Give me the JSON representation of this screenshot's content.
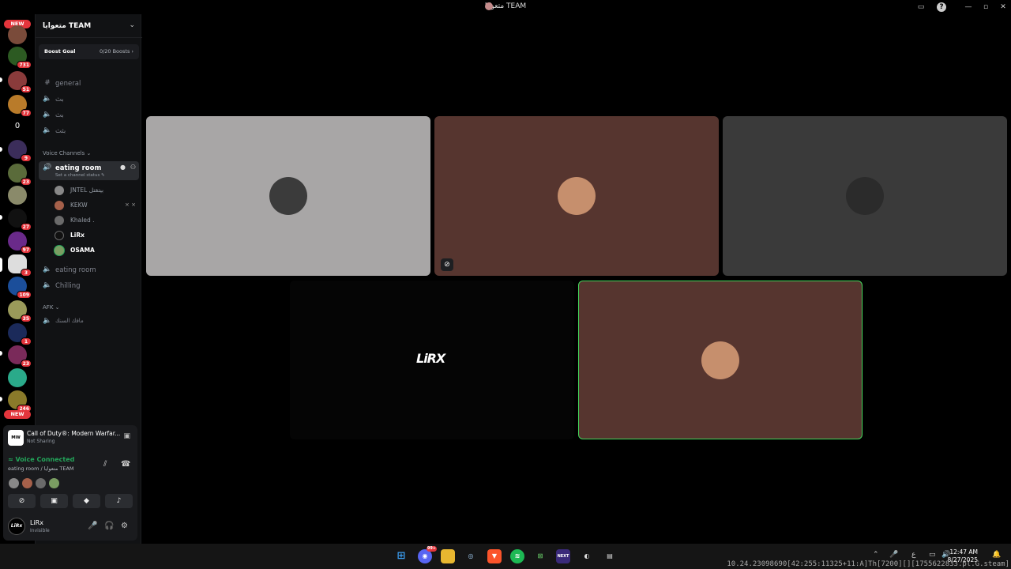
{
  "window": {
    "title": "متعوايا TEAM"
  },
  "rail": {
    "new_label": "NEW",
    "servers": [
      {
        "badge": ""
      },
      {
        "badge": "731"
      },
      {
        "badge": "51"
      },
      {
        "badge": "77"
      },
      {
        "label": "0",
        "badge": ""
      },
      {
        "badge": "9"
      },
      {
        "badge": "23"
      },
      {
        "badge": ""
      },
      {
        "badge": "27"
      },
      {
        "badge": "97"
      },
      {
        "badge": "3"
      },
      {
        "badge": "109"
      },
      {
        "badge": "35"
      },
      {
        "badge": "1"
      },
      {
        "badge": "23"
      },
      {
        "badge": ""
      },
      {
        "badge": "246"
      }
    ]
  },
  "server": {
    "name": "متعوايا TEAM",
    "boost_label": "Boost Goal",
    "boost_count": "0/20 Boosts ›"
  },
  "text_channels": [
    {
      "name": "general"
    },
    {
      "name": "بث"
    },
    {
      "name": "بث"
    },
    {
      "name": "بثث"
    }
  ],
  "voice_category": "Voice Channels ⌄",
  "active_channel": {
    "name": "eating room",
    "status": "Set a channel status ✎"
  },
  "members": [
    {
      "name": "JNTEL بيتقتل",
      "color": "#888888"
    },
    {
      "name": "KEKW",
      "color": "#a5604a",
      "icons": "⨯ ⨯"
    },
    {
      "name": "Khaled .",
      "color": "#6a6a6a"
    },
    {
      "name": "LiRx",
      "color": "#111111"
    },
    {
      "name": "OSAMA",
      "color": "#7a9d62"
    }
  ],
  "other_channels": [
    {
      "name": "eating room"
    },
    {
      "name": "Chilling"
    }
  ],
  "afk_category": "AFK ⌄",
  "afk_channel": {
    "name": "مافك السنك"
  },
  "activity": {
    "icon_text": "MW",
    "game": "Call of Duty®: Modern Warfar...",
    "sub": "Not Sharing"
  },
  "voice": {
    "status": "Voice Connected",
    "location": "eating room / متعوايا TEAM"
  },
  "user": {
    "avatar_text": "LiRx",
    "name": "LiRx",
    "status": "Invisible"
  },
  "tiles": [
    {
      "bg": "#a8a6a6",
      "avatar": "#3b3b3b"
    },
    {
      "bg": "#56352f",
      "avatar": "#c68f6d",
      "icon": "⊘"
    },
    {
      "bg": "#3a3a3a",
      "avatar": "#2b2b2b"
    },
    {
      "bg": "#050505",
      "logo": "LiRX"
    },
    {
      "bg": "#56352f",
      "avatar": "#c68f6d",
      "speaking": true
    }
  ],
  "taskbar": {
    "discord_badge": "99+",
    "next_label": "NEXT",
    "lang": "ع",
    "time": "12:47 AM",
    "date": "8/27/2025"
  },
  "debug_text": "10.24.23098690[42:255:11325+11:A]Th[7200][][1755622833.pl.G.steam]"
}
